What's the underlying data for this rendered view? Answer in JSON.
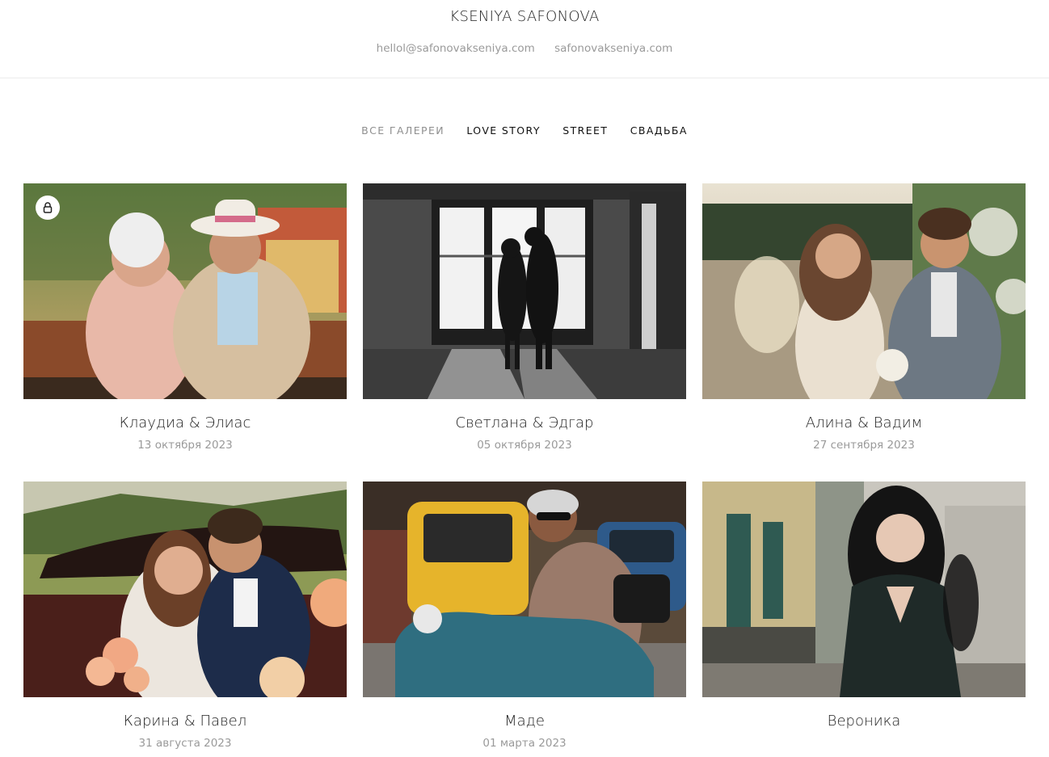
{
  "header": {
    "brand": "KSENIYA SAFONOVA",
    "email": "hellol@safonovakseniya.com",
    "website": "safonovakseniya.com"
  },
  "nav": {
    "items": [
      {
        "label": "ВСЕ ГАЛЕРЕИ",
        "active": true
      },
      {
        "label": "LOVE STORY",
        "active": false
      },
      {
        "label": "STREET",
        "active": false
      },
      {
        "label": "СВАДЬБА",
        "active": false
      }
    ]
  },
  "galleries": [
    {
      "title": "Клаудиа & Элиас",
      "date": "13 октября 2023",
      "locked": true
    },
    {
      "title": "Светлана & Эдгар",
      "date": "05 октября 2023",
      "locked": false
    },
    {
      "title": "Алина & Вадим",
      "date": "27 сентября 2023",
      "locked": false
    },
    {
      "title": "Карина & Павел",
      "date": "31 августа 2023",
      "locked": false
    },
    {
      "title": "Маде",
      "date": "01 марта 2023",
      "locked": false
    },
    {
      "title": "Вероника",
      "date": "",
      "locked": false
    }
  ],
  "icons": {
    "lock": "lock-icon"
  }
}
